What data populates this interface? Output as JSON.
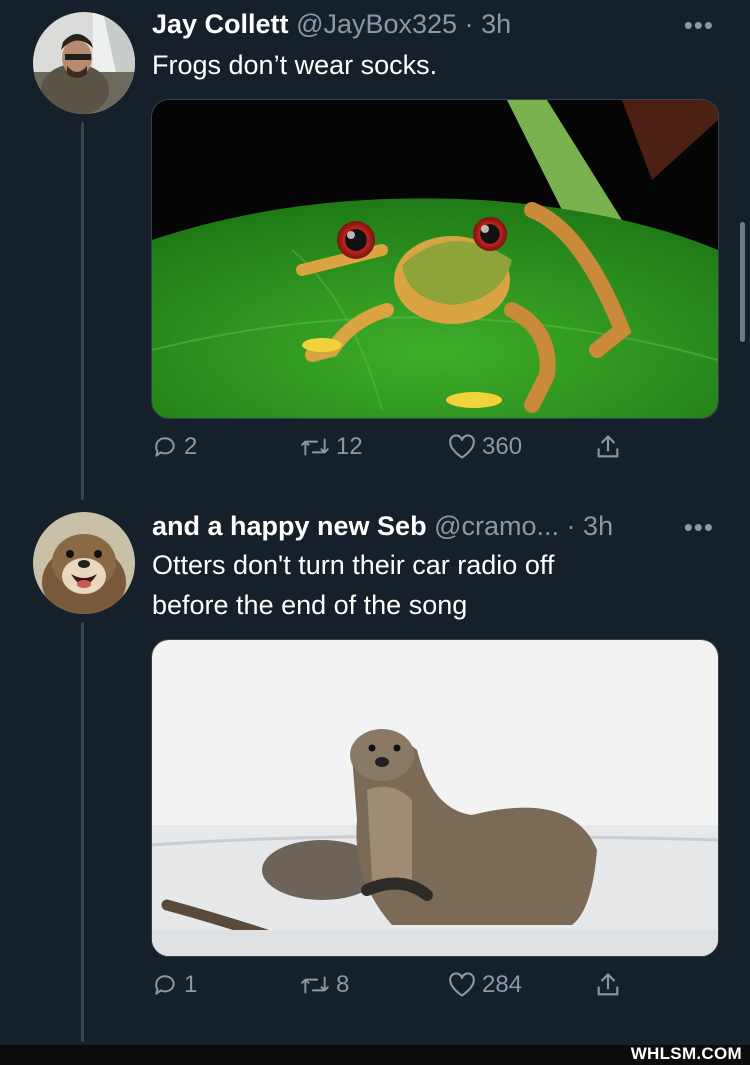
{
  "tweets": [
    {
      "name": "Jay Collett",
      "handle": "@JayBox325",
      "separator": "·",
      "time": "3h",
      "text": "Frogs don’t wear socks.",
      "counts": {
        "replies": "2",
        "retweets": "12",
        "likes": "360"
      }
    },
    {
      "name": "and a happy new Seb",
      "handle": "@cramo...",
      "separator": "·",
      "time": "3h",
      "text_line1": "Otters don't turn their car radio off",
      "text_line2": "before the end of the song",
      "counts": {
        "replies": "1",
        "retweets": "8",
        "likes": "284"
      }
    }
  ],
  "more_glyph": "•••",
  "watermark": "WHLSM.COM",
  "colors": {
    "background": "#15202b",
    "secondary_text": "#8899a6",
    "thread_line": "#38444d"
  }
}
